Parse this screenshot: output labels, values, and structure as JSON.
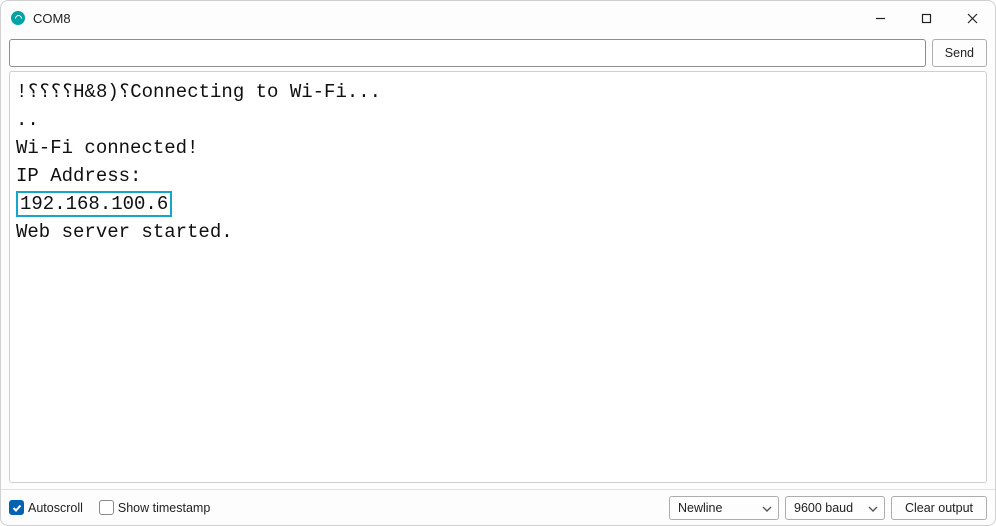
{
  "window": {
    "title": "COM8"
  },
  "sendrow": {
    "input_value": "",
    "input_placeholder": "",
    "send_label": "Send"
  },
  "console": {
    "lines": [
      "!⸮⸮⸮⸮H&8)⸮Connecting to Wi-Fi...",
      "..",
      "Wi-Fi connected!",
      "IP Address:",
      "192.168.100.6",
      "Web server started."
    ],
    "highlight_index": 4
  },
  "bottombar": {
    "autoscroll": {
      "label": "Autoscroll",
      "checked": true
    },
    "show_timestamp": {
      "label": "Show timestamp",
      "checked": false
    },
    "line_ending": {
      "selected": "Newline"
    },
    "baud": {
      "selected": "9600 baud"
    },
    "clear_label": "Clear output"
  }
}
